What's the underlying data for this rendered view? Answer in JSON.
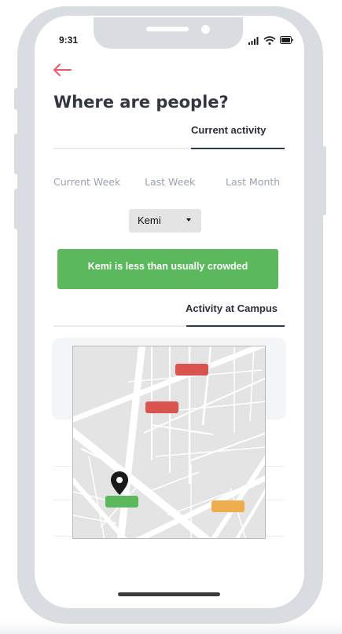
{
  "status_bar": {
    "time": "9:31"
  },
  "header": {
    "back_icon": "arrow-left-icon",
    "title": "Where are people?"
  },
  "tabs": {
    "current_activity": "Current activity",
    "activity_at_campus": "Activity at Campus"
  },
  "periods": [
    {
      "label": "Current Week"
    },
    {
      "label": "Last Week"
    },
    {
      "label": "Last Month"
    }
  ],
  "location_select": {
    "value": "Kemi"
  },
  "banner": {
    "text": "Kemi is less than usually crowded"
  },
  "map": {
    "pin_icon": "location-pin-icon",
    "markers": [
      {
        "status": "busy",
        "color": "#d9534f"
      },
      {
        "status": "busy",
        "color": "#d9534f"
      },
      {
        "status": "quiet",
        "color": "#5cb85c"
      },
      {
        "status": "moderate",
        "color": "#f0ad4e"
      }
    ]
  },
  "colors": {
    "accent": "#f0566a",
    "success": "#5cb85c",
    "busy": "#d9534f",
    "moderate": "#f0ad4e"
  }
}
